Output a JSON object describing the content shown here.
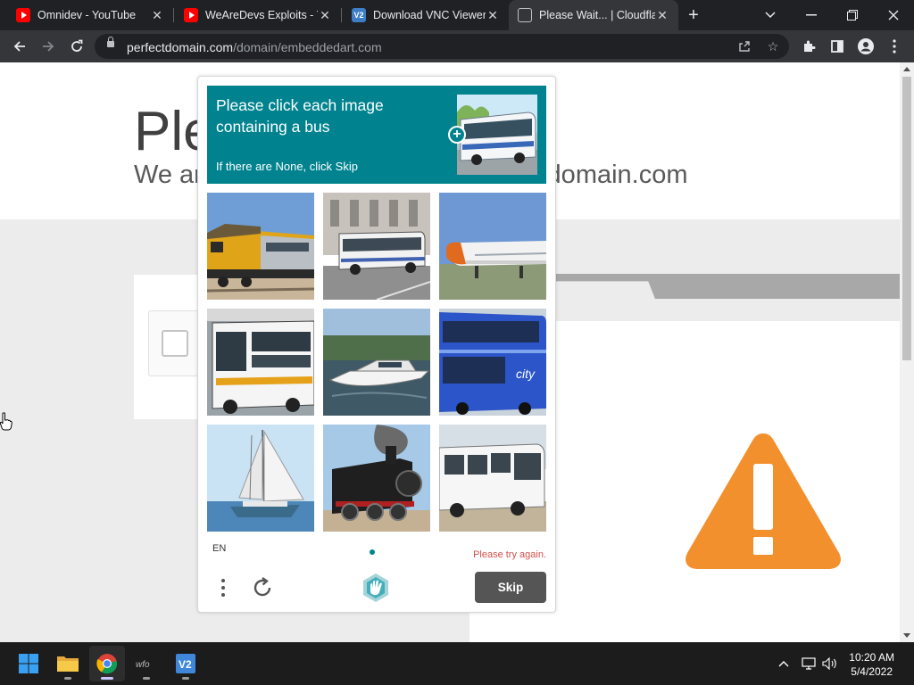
{
  "browser": {
    "tabs": [
      {
        "title": "Omnidev - YouTube",
        "icon": "youtube-icon"
      },
      {
        "title": "WeAreDevs Exploits - Y",
        "icon": "youtube-icon"
      },
      {
        "title": "Download VNC Viewer",
        "icon": "vnc-icon"
      },
      {
        "title": "Please Wait... | Cloudfla",
        "icon": "globe-icon",
        "active": true
      }
    ],
    "url_domain": "perfectdomain.com",
    "url_path": "/domain/embeddedart.com"
  },
  "page": {
    "title_partial": "Ple",
    "subtitle_left": "We ar",
    "subtitle_right": "ctdomain.com"
  },
  "captcha": {
    "prompt_line": "Please click each image containing a bus",
    "prompt_sub": "If there are None, click Skip",
    "tiles": [
      "train",
      "bus",
      "airplane",
      "bus",
      "boat",
      "bus",
      "sailboat",
      "train",
      "bus"
    ],
    "language": "EN",
    "error": "Please try again.",
    "skip_label": "Skip",
    "brand_color": "#00838f",
    "error_color": "#d0504c"
  },
  "taskbar": {
    "apps": [
      "windows-start-icon",
      "file-explorer-icon",
      "chrome-icon",
      "wfo-icon",
      "vnc-viewer-icon"
    ],
    "time": "10:20 AM",
    "date": "5/4/2022"
  }
}
